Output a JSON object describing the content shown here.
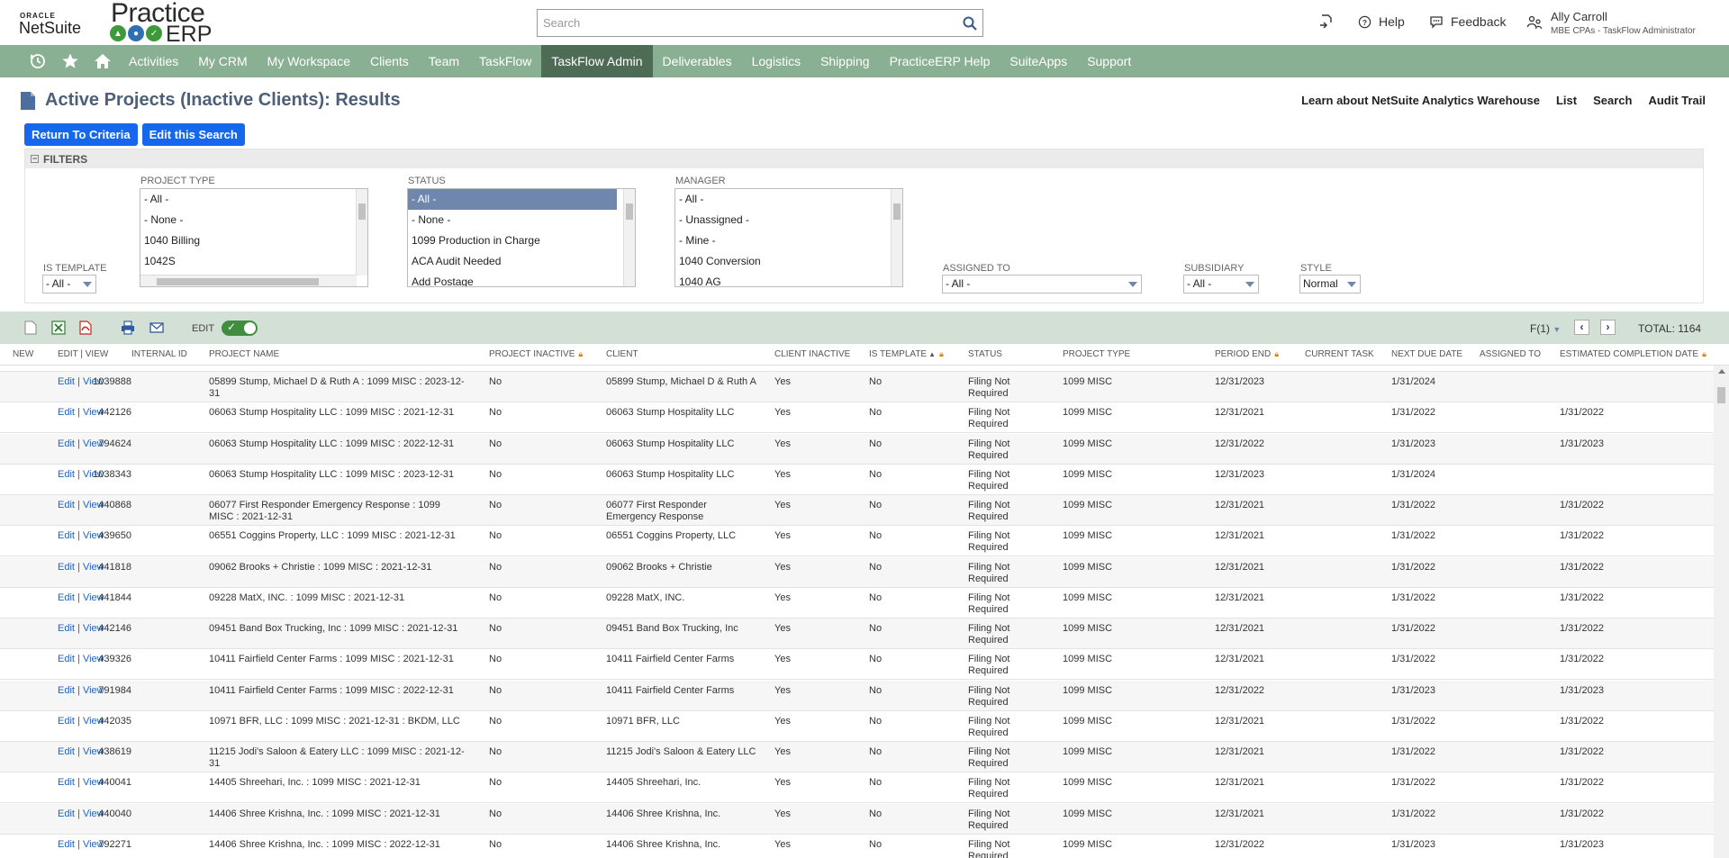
{
  "header": {
    "oracle": "ORACLE",
    "netsuite": "NetSuite",
    "practice": "Practice",
    "erp": "ERP",
    "search_placeholder": "Search",
    "help": "Help",
    "feedback": "Feedback",
    "user_name": "Ally Carroll",
    "user_role": "MBE CPAs - TaskFlow Administrator"
  },
  "nav": {
    "items": [
      "Activities",
      "My CRM",
      "My Workspace",
      "Clients",
      "Team",
      "TaskFlow",
      "TaskFlow Admin",
      "Deliverables",
      "Logistics",
      "Shipping",
      "PracticeERP Help",
      "SuiteApps",
      "Support"
    ],
    "active": "TaskFlow Admin"
  },
  "page": {
    "title": "Active Projects (Inactive Clients): Results",
    "links": [
      "Learn about NetSuite Analytics Warehouse",
      "List",
      "Search",
      "Audit Trail"
    ],
    "return_button": "Return To Criteria",
    "edit_search_button": "Edit this Search"
  },
  "filters": {
    "heading": "FILTERS",
    "is_template": {
      "label": "IS TEMPLATE",
      "value": "- All -"
    },
    "project_type": {
      "label": "PROJECT TYPE",
      "options": [
        "- All -",
        "- None -",
        "1040 Billing",
        "1042S"
      ]
    },
    "status": {
      "label": "STATUS",
      "options": [
        "- All -",
        "- None -",
        "1099 Production in Charge",
        "ACA Audit Needed",
        "Add Postage"
      ]
    },
    "manager": {
      "label": "MANAGER",
      "options": [
        "- All -",
        "- Unassigned -",
        "- Mine -",
        "1040 Conversion",
        "1040 AG"
      ]
    },
    "assigned_to": {
      "label": "ASSIGNED TO",
      "value": "- All -"
    },
    "subsidiary": {
      "label": "SUBSIDIARY",
      "value": "- All -"
    },
    "style": {
      "label": "STYLE",
      "value": "Normal"
    }
  },
  "toolbar": {
    "edit_label": "EDIT",
    "pager": "F(1)",
    "total": "TOTAL: 1164"
  },
  "table": {
    "columns": [
      "NEW",
      "EDIT | VIEW",
      "INTERNAL ID",
      "PROJECT NAME",
      "PROJECT INACTIVE",
      "CLIENT",
      "CLIENT INACTIVE",
      "IS TEMPLATE",
      "STATUS",
      "PROJECT TYPE",
      "PERIOD END",
      "CURRENT TASK",
      "NEXT DUE DATE",
      "ASSIGNED TO",
      "ESTIMATED COMPLETION DATE"
    ],
    "edit_text": "Edit",
    "view_text": "View",
    "rows": [
      {
        "id": "1039888",
        "name": "05899 Stump, Michael D & Ruth A : 1099 MISC : 2023-12-31",
        "inactive": "No",
        "client": "05899 Stump, Michael D & Ruth A",
        "client_inactive": "Yes",
        "template": "No",
        "status": "Filing Not Required",
        "type": "1099 MISC",
        "period_end": "12/31/2023",
        "due": "1/31/2024",
        "est": ""
      },
      {
        "id": "442126",
        "name": "06063 Stump Hospitality LLC : 1099 MISC : 2021-12-31",
        "inactive": "No",
        "client": "06063 Stump Hospitality LLC",
        "client_inactive": "Yes",
        "template": "No",
        "status": "Filing Not Required",
        "type": "1099 MISC",
        "period_end": "12/31/2021",
        "due": "1/31/2022",
        "est": "1/31/2022"
      },
      {
        "id": "794624",
        "name": "06063 Stump Hospitality LLC : 1099 MISC : 2022-12-31",
        "inactive": "No",
        "client": "06063 Stump Hospitality LLC",
        "client_inactive": "Yes",
        "template": "No",
        "status": "Filing Not Required",
        "type": "1099 MISC",
        "period_end": "12/31/2022",
        "due": "1/31/2023",
        "est": "1/31/2023"
      },
      {
        "id": "1038343",
        "name": "06063 Stump Hospitality LLC : 1099 MISC : 2023-12-31",
        "inactive": "No",
        "client": "06063 Stump Hospitality LLC",
        "client_inactive": "Yes",
        "template": "No",
        "status": "Filing Not Required",
        "type": "1099 MISC",
        "period_end": "12/31/2023",
        "due": "1/31/2024",
        "est": ""
      },
      {
        "id": "440868",
        "name": "06077 First Responder Emergency Response : 1099 MISC : 2021-12-31",
        "inactive": "No",
        "client": "06077 First Responder Emergency Response",
        "client_inactive": "Yes",
        "template": "No",
        "status": "Filing Not Required",
        "type": "1099 MISC",
        "period_end": "12/31/2021",
        "due": "1/31/2022",
        "est": "1/31/2022"
      },
      {
        "id": "439650",
        "name": "06551 Coggins Property, LLC : 1099 MISC : 2021-12-31",
        "inactive": "No",
        "client": "06551 Coggins Property, LLC",
        "client_inactive": "Yes",
        "template": "No",
        "status": "Filing Not Required",
        "type": "1099 MISC",
        "period_end": "12/31/2021",
        "due": "1/31/2022",
        "est": "1/31/2022"
      },
      {
        "id": "441818",
        "name": "09062 Brooks + Christie : 1099 MISC : 2021-12-31",
        "inactive": "No",
        "client": "09062 Brooks + Christie",
        "client_inactive": "Yes",
        "template": "No",
        "status": "Filing Not Required",
        "type": "1099 MISC",
        "period_end": "12/31/2021",
        "due": "1/31/2022",
        "est": "1/31/2022"
      },
      {
        "id": "441844",
        "name": "09228 MatX, INC. : 1099 MISC : 2021-12-31",
        "inactive": "No",
        "client": "09228 MatX, INC.",
        "client_inactive": "Yes",
        "template": "No",
        "status": "Filing Not Required",
        "type": "1099 MISC",
        "period_end": "12/31/2021",
        "due": "1/31/2022",
        "est": "1/31/2022"
      },
      {
        "id": "442146",
        "name": "09451 Band Box Trucking, Inc : 1099 MISC : 2021-12-31",
        "inactive": "No",
        "client": "09451 Band Box Trucking, Inc",
        "client_inactive": "Yes",
        "template": "No",
        "status": "Filing Not Required",
        "type": "1099 MISC",
        "period_end": "12/31/2021",
        "due": "1/31/2022",
        "est": "1/31/2022"
      },
      {
        "id": "439326",
        "name": "10411 Fairfield Center Farms : 1099 MISC : 2021-12-31",
        "inactive": "No",
        "client": "10411 Fairfield Center Farms",
        "client_inactive": "Yes",
        "template": "No",
        "status": "Filing Not Required",
        "type": "1099 MISC",
        "period_end": "12/31/2021",
        "due": "1/31/2022",
        "est": "1/31/2022"
      },
      {
        "id": "791984",
        "name": "10411 Fairfield Center Farms : 1099 MISC : 2022-12-31",
        "inactive": "No",
        "client": "10411 Fairfield Center Farms",
        "client_inactive": "Yes",
        "template": "No",
        "status": "Filing Not Required",
        "type": "1099 MISC",
        "period_end": "12/31/2022",
        "due": "1/31/2023",
        "est": "1/31/2023"
      },
      {
        "id": "442035",
        "name": "10971 BFR, LLC : 1099 MISC : 2021-12-31 : BKDM, LLC",
        "inactive": "No",
        "client": "10971 BFR, LLC",
        "client_inactive": "Yes",
        "template": "No",
        "status": "Filing Not Required",
        "type": "1099 MISC",
        "period_end": "12/31/2021",
        "due": "1/31/2022",
        "est": "1/31/2022"
      },
      {
        "id": "438619",
        "name": "11215 Jodi's Saloon & Eatery LLC : 1099 MISC : 2021-12-31",
        "inactive": "No",
        "client": "11215 Jodi's Saloon & Eatery LLC",
        "client_inactive": "Yes",
        "template": "No",
        "status": "Filing Not Required",
        "type": "1099 MISC",
        "period_end": "12/31/2021",
        "due": "1/31/2022",
        "est": "1/31/2022"
      },
      {
        "id": "440041",
        "name": "14405 Shreehari, Inc. : 1099 MISC : 2021-12-31",
        "inactive": "No",
        "client": "14405 Shreehari, Inc.",
        "client_inactive": "Yes",
        "template": "No",
        "status": "Filing Not Required",
        "type": "1099 MISC",
        "period_end": "12/31/2021",
        "due": "1/31/2022",
        "est": "1/31/2022"
      },
      {
        "id": "440040",
        "name": "14406 Shree Krishna, Inc. : 1099 MISC : 2021-12-31",
        "inactive": "No",
        "client": "14406 Shree Krishna, Inc.",
        "client_inactive": "Yes",
        "template": "No",
        "status": "Filing Not Required",
        "type": "1099 MISC",
        "period_end": "12/31/2021",
        "due": "1/31/2022",
        "est": "1/31/2022"
      },
      {
        "id": "792271",
        "name": "14406 Shree Krishna, Inc. : 1099 MISC : 2022-12-31",
        "inactive": "No",
        "client": "14406 Shree Krishna, Inc.",
        "client_inactive": "Yes",
        "template": "No",
        "status": "Filing Not Required",
        "type": "1099 MISC",
        "period_end": "12/31/2022",
        "due": "1/31/2023",
        "est": "1/31/2023"
      }
    ]
  },
  "colors": {
    "nav_bg": "#8ab093",
    "nav_active": "#4e6b56",
    "button_blue": "#1666ee",
    "link_blue": "#2462b9",
    "title_color": "#4d5f79",
    "toolbar_bg": "#d2e0d5"
  },
  "icons": [
    "history-icon",
    "star-icon",
    "home-icon",
    "search-icon",
    "help-icon",
    "feedback-icon",
    "user-roles-icon",
    "new-doc-icon",
    "excel-icon",
    "pdf-icon",
    "print-icon",
    "email-icon"
  ]
}
